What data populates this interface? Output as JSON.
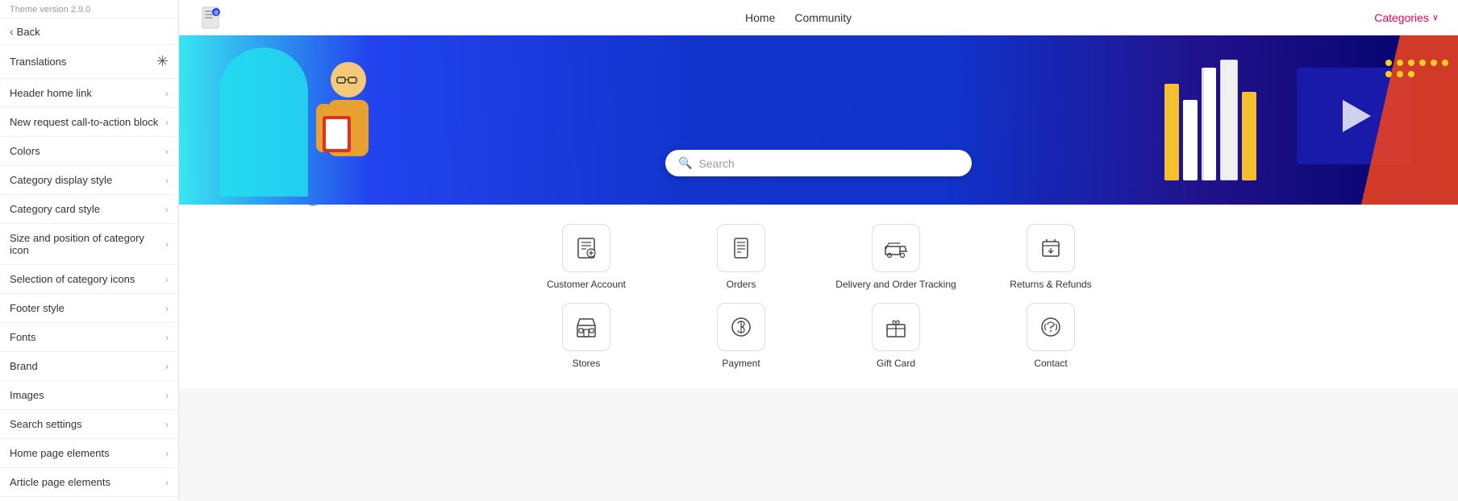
{
  "sidebar": {
    "version": "Theme version 2.9.0",
    "back_label": "Back",
    "items": [
      {
        "id": "translations",
        "label": "Translations",
        "has_icon": true,
        "icon": "❊"
      },
      {
        "id": "header-home-link",
        "label": "Header home link",
        "has_icon": false
      },
      {
        "id": "new-request-cta",
        "label": "New request call-to-action block",
        "has_icon": false
      },
      {
        "id": "colors",
        "label": "Colors",
        "has_icon": false
      },
      {
        "id": "category-display-style",
        "label": "Category display style",
        "has_icon": false
      },
      {
        "id": "category-card-style",
        "label": "Category card style",
        "has_icon": false
      },
      {
        "id": "size-position-category-icon",
        "label": "Size and position of category icon",
        "has_icon": false
      },
      {
        "id": "selection-category-icons",
        "label": "Selection of category icons",
        "has_icon": false
      },
      {
        "id": "footer-style",
        "label": "Footer style",
        "has_icon": false
      },
      {
        "id": "fonts",
        "label": "Fonts",
        "has_icon": false
      },
      {
        "id": "brand",
        "label": "Brand",
        "has_icon": false
      },
      {
        "id": "images",
        "label": "Images",
        "has_icon": false
      },
      {
        "id": "search-settings",
        "label": "Search settings",
        "has_icon": false
      },
      {
        "id": "home-page-elements",
        "label": "Home page elements",
        "has_icon": false
      },
      {
        "id": "article-page-elements",
        "label": "Article page elements",
        "has_icon": false
      }
    ]
  },
  "topnav": {
    "home_label": "Home",
    "community_label": "Community",
    "categories_label": "Categories"
  },
  "hero": {
    "search_placeholder": "Search"
  },
  "categories": [
    {
      "id": "customer-account",
      "icon": "📋",
      "label": "Customer Account"
    },
    {
      "id": "orders",
      "icon": "🗒",
      "label": "Orders"
    },
    {
      "id": "delivery-tracking",
      "icon": "🛒",
      "label": "Delivery and Order Tracking"
    },
    {
      "id": "returns-refunds",
      "icon": "📦",
      "label": "Returns & Refunds"
    },
    {
      "id": "stores",
      "icon": "🏪",
      "label": "Stores"
    },
    {
      "id": "payment",
      "icon": "💲",
      "label": "Payment"
    },
    {
      "id": "gift-card",
      "icon": "🎁",
      "label": "Gift Card"
    },
    {
      "id": "contact",
      "icon": "🎧",
      "label": "Contact"
    }
  ]
}
